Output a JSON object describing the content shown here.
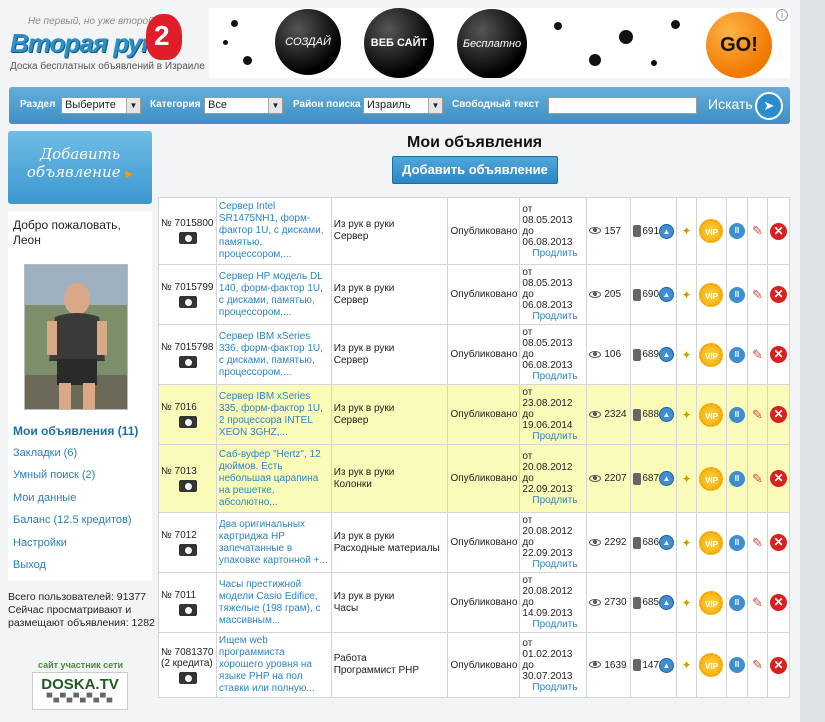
{
  "logo": {
    "slogan": "Не первый, но уже второй!",
    "brand": "Вторая рука",
    "badge": "2",
    "subtitle": "Доска бесплатных объявлений в Израиле"
  },
  "banner": {
    "ball1": "СОЗДАЙ",
    "ball2": "ВЕБ САЙТ",
    "ball3": "Бесплатно",
    "go": "GO!",
    "info": "i"
  },
  "search": {
    "section_label": "Раздел",
    "section_value": "Выберите",
    "category_label": "Категория",
    "category_value": "Все",
    "area_label": "Район поиска",
    "area_value": "Израиль",
    "free_text_label": "Свободный текст",
    "free_text_value": "",
    "search_label": "Искать"
  },
  "sidebar": {
    "add_button": "Добавить объявление",
    "greeting": "Добро пожаловать, Леон",
    "menu": [
      "Мои объявления (11)",
      "Закладки (6)",
      "Умный поиск (2)",
      "Мои данные",
      "Баланс (12.5 кредитов)",
      "Настройки",
      "Выход"
    ],
    "stats": "Всего пользователей: 91377 Сейчас просматривают и размещают объявления: 1282",
    "partner": "сайт участник сети",
    "doska": "DOSKA.TV"
  },
  "main": {
    "title": "Мои объявления",
    "add_button": "Добавить объявление",
    "extend_label": "Продлить",
    "vip_label": "VIP",
    "rows": [
      {
        "num": "№ 7015800",
        "title": "Сервер Intel SR1475NH1, форм-фактор 1U, с дисками, памятью, процессором,...",
        "cat1": "Из рук в руки",
        "cat2": "Сервер",
        "status": "Опубликовано",
        "from": "от 08.05.2013",
        "to": "до 06.08.2013",
        "views": "157",
        "up": "691",
        "hl": false
      },
      {
        "num": "№ 7015799",
        "title": "Сервер HP модель DL 140, форм-фактор 1U, с дисками, памятью, процессором,...",
        "cat1": "Из рук в руки",
        "cat2": "Сервер",
        "status": "Опубликовано",
        "from": "от 08.05.2013",
        "to": "до 06.08.2013",
        "views": "205",
        "up": "690",
        "hl": false
      },
      {
        "num": "№ 7015798",
        "title": "Сервер IBM xSeries 336, форм-фактор 1U, с дисками, памятью, процессором,...",
        "cat1": "Из рук в руки",
        "cat2": "Сервер",
        "status": "Опубликовано",
        "from": "от 08.05.2013",
        "to": "до 06.08.2013",
        "views": "106",
        "up": "689",
        "hl": false
      },
      {
        "num": "№ 7016",
        "title": "Сервер IBM xSeries 335, форм-фактор 1U, 2 процессора INTEL XEON 3GHZ,...",
        "cat1": "Из рук в руки",
        "cat2": "Сервер",
        "status": "Опубликовано",
        "from": "от 23.08.2012",
        "to": "до 19.06.2014",
        "views": "2324",
        "up": "688",
        "hl": true
      },
      {
        "num": "№ 7013",
        "title": "Саб-вуфер \"Hertz\", 12 дюймов. Есть небольшая царапина на решетке, абсолютно...",
        "cat1": "Из рук в руки",
        "cat2": "Колонки",
        "status": "Опубликовано",
        "from": "от 20.08.2012",
        "to": "до 22.09.2013",
        "views": "2207",
        "up": "687",
        "hl": true
      },
      {
        "num": "№ 7012",
        "title": "Два оригинальных картриджа HP запечатанные в упаковке картонной +...",
        "cat1": "Из рук в руки",
        "cat2": "Расходные материалы",
        "status": "Опубликовано",
        "from": "от 20.08.2012",
        "to": "до 22.09.2013",
        "views": "2292",
        "up": "686",
        "hl": false
      },
      {
        "num": "№ 7011",
        "title": "Часы престижной модели Casio Edifice, тяжелые (198 грам), с массивным...",
        "cat1": "Из рук в руки",
        "cat2": "Часы",
        "status": "Опубликовано",
        "from": "от 20.08.2012",
        "to": "до 14.09.2013",
        "views": "2730",
        "up": "685",
        "hl": false
      },
      {
        "num": "№ 7081370 (2 кредита)",
        "title": "Ищем web программиста хорошего уровня на языке PHP на пол ставки или полную...",
        "cat1": "Работа",
        "cat2": "Программист PHP",
        "status": "Опубликовано",
        "from": "от 01.02.2013",
        "to": "до 30.07.2013",
        "views": "1639",
        "up": "147",
        "hl": false
      }
    ]
  }
}
